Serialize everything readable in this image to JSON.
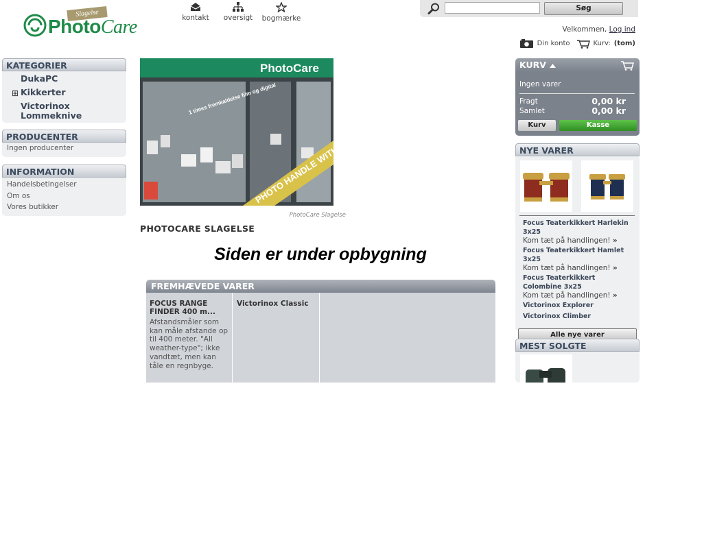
{
  "header": {
    "logo": {
      "badge": "Slagelse",
      "word_a": "Photo",
      "word_b": "Care"
    },
    "nav": [
      {
        "label": "kontakt",
        "icon": "mail-icon"
      },
      {
        "label": "oversigt",
        "icon": "sitemap-icon"
      },
      {
        "label": "bogmærke",
        "icon": "star-icon"
      }
    ],
    "search": {
      "value": "",
      "button": "Søg"
    },
    "welcome_text": "Velkommen,",
    "login_link": "Log ind",
    "account_label": "Din konto",
    "cart_label": "Kurv:",
    "cart_state": "(tom)"
  },
  "left": {
    "categories": {
      "title": "KATEGORIER",
      "items": [
        {
          "label": "DukaPC",
          "expand": ""
        },
        {
          "label": "Kikkerter",
          "expand": "⊞"
        },
        {
          "label": "Victorinox Lommeknive",
          "expand": ""
        }
      ]
    },
    "producers": {
      "title": "PRODUCENTER",
      "empty": "Ingen producenter"
    },
    "information": {
      "title": "INFORMATION",
      "links": [
        "Handelsbetingelser",
        "Om os",
        "Vores butikker"
      ]
    }
  },
  "main": {
    "photo": {
      "sign": "PhotoCare",
      "window_text": "1 times fremkaldelse film og digital",
      "banner": "PHOTO HANDLE WITH CARE",
      "caption": "PhotoCare Slagelse"
    },
    "title": "PHOTOCARE SLAGELSE",
    "notice": "Siden er under opbygning",
    "featured": {
      "title": "FREMHÆVEDE VARER",
      "items": [
        {
          "name": "FOCUS RANGE FINDER 400 m...",
          "desc": "Afstandsmåler som kan måle afstande op til 400 meter. \"All weather-type\"; ikke vandtæt, men kan tåle en regnbyge."
        },
        {
          "name": "Victorinox Classic",
          "desc": ""
        }
      ]
    }
  },
  "right": {
    "cart": {
      "title": "KURV",
      "empty": "Ingen varer",
      "freight_label": "Fragt",
      "freight_value": "0,00 kr",
      "total_label": "Samlet",
      "total_value": "0,00 kr",
      "cart_button": "Kurv",
      "checkout_button": "Kasse"
    },
    "new_items": {
      "title": "NYE VARER",
      "products": [
        {
          "name": "Focus Teaterkikkert Harlekin 3x25",
          "more": "Kom tæt på handlingen!"
        },
        {
          "name": "Focus Teaterkikkert Hamlet 3x25",
          "more": "Kom tæt på handlingen!"
        },
        {
          "name": "Focus Teaterkikkert Colombine 3x25",
          "more": "Kom tæt på handlingen!"
        },
        {
          "name": "Victorinox Explorer",
          "more": ""
        },
        {
          "name": "Victorinox Climber",
          "more": ""
        }
      ],
      "all_button": "Alle nye varer"
    },
    "best_sellers": {
      "title": "MEST SOLGTE"
    }
  }
}
